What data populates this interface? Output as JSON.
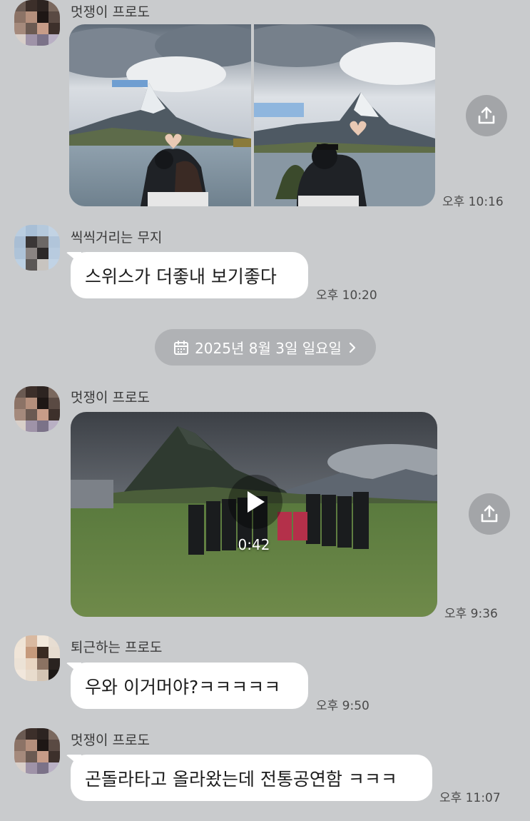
{
  "colors": {
    "background": "#c9cbcd",
    "bubble": "#ffffff",
    "share_button": "#a3a5a8",
    "date_pill": "#b0b2b5"
  },
  "messages": [
    {
      "sender": "멋쟁이 프로도",
      "type": "photos",
      "photo_count": 2,
      "photo_contents": [
        "matterhorn-couple-heart-photo",
        "matterhorn-single-heart-photo"
      ],
      "time": "오후 10:16"
    },
    {
      "sender": "씩씩거리는 무지",
      "type": "text",
      "text": "스위스가  더좋내 보기좋다",
      "time": "오후 10:20"
    },
    {
      "sender": "멋쟁이 프로도",
      "type": "video",
      "duration": "0:42",
      "time": "오후 9:36"
    },
    {
      "sender": "퇴근하는 프로도",
      "type": "text",
      "text": "우와 이거머야?ㅋㅋㅋㅋㅋ",
      "time": "오후 9:50"
    },
    {
      "sender": "멋쟁이 프로도",
      "type": "text",
      "text": "곤돌라타고 올라왔는데 전통공연함 ㅋㅋㅋ",
      "time": "오후 11:07"
    }
  ],
  "date_divider": {
    "label": "2025년 8월 3일 일요일",
    "icon": "calendar-icon",
    "chevron": "chevron-right-icon"
  }
}
